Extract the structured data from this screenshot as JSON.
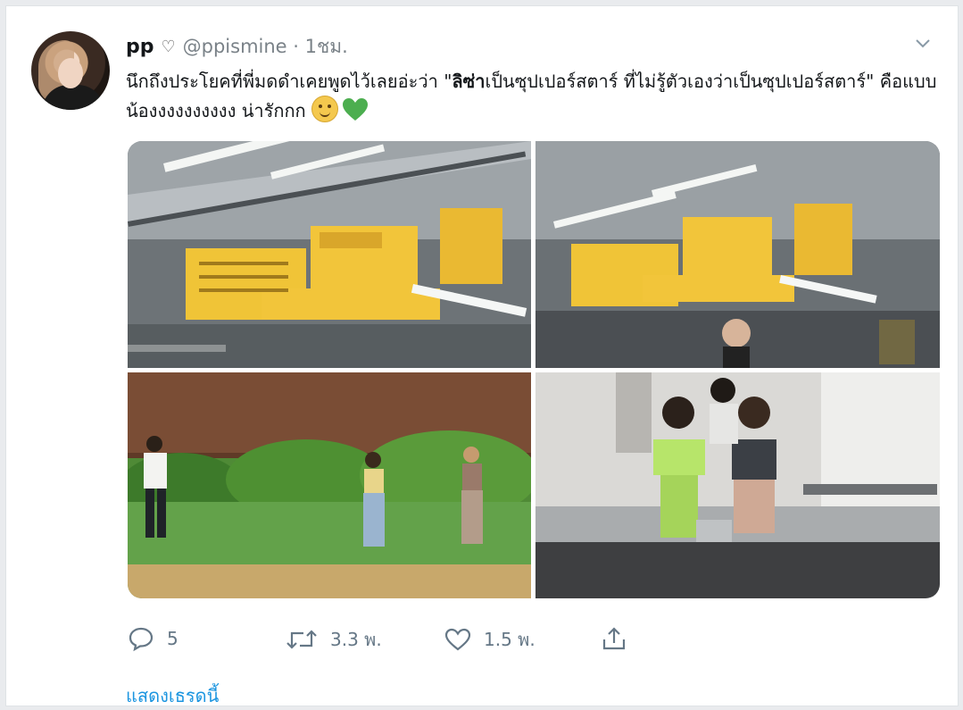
{
  "tweet": {
    "author_name": "pp",
    "author_heart": "♡",
    "handle_time": "@ppismine · 1ชม.",
    "text_part1": "นึกถึงประโยคที่พี่มดดำเคยพูดไว้เลยอ่ะว่า \"",
    "text_highlight": "ลิซ่า",
    "text_part2": "เป็นซุปเปอร์สตาร์ ที่ไม่รู้ตัวเองว่าเป็นซุปเปอร์สตาร์\" คือแบบน้องงงงงงงงงง น่ารักกก",
    "emojis": [
      "smiling-face-emoji",
      "green-heart-emoji"
    ]
  },
  "media": {
    "photos": [
      {
        "label": "noodle shop signboards"
      },
      {
        "label": "noodle shop signboards with customer"
      },
      {
        "label": "people walking past garden"
      },
      {
        "label": "girls at shop counter"
      }
    ]
  },
  "actions": {
    "reply_count": "5",
    "retweet_count": "3.3 พ.",
    "like_count": "1.5 พ.",
    "icons": [
      "reply-icon",
      "retweet-icon",
      "like-icon",
      "share-icon"
    ]
  },
  "footer": {
    "show_thread": "แสดงเธรดนี้"
  },
  "colors": {
    "link": "#1b95e0",
    "muted": "#657786",
    "text": "#14171a",
    "sign_yellow": "#f2c53a",
    "heart_green": "#4cae4f"
  }
}
